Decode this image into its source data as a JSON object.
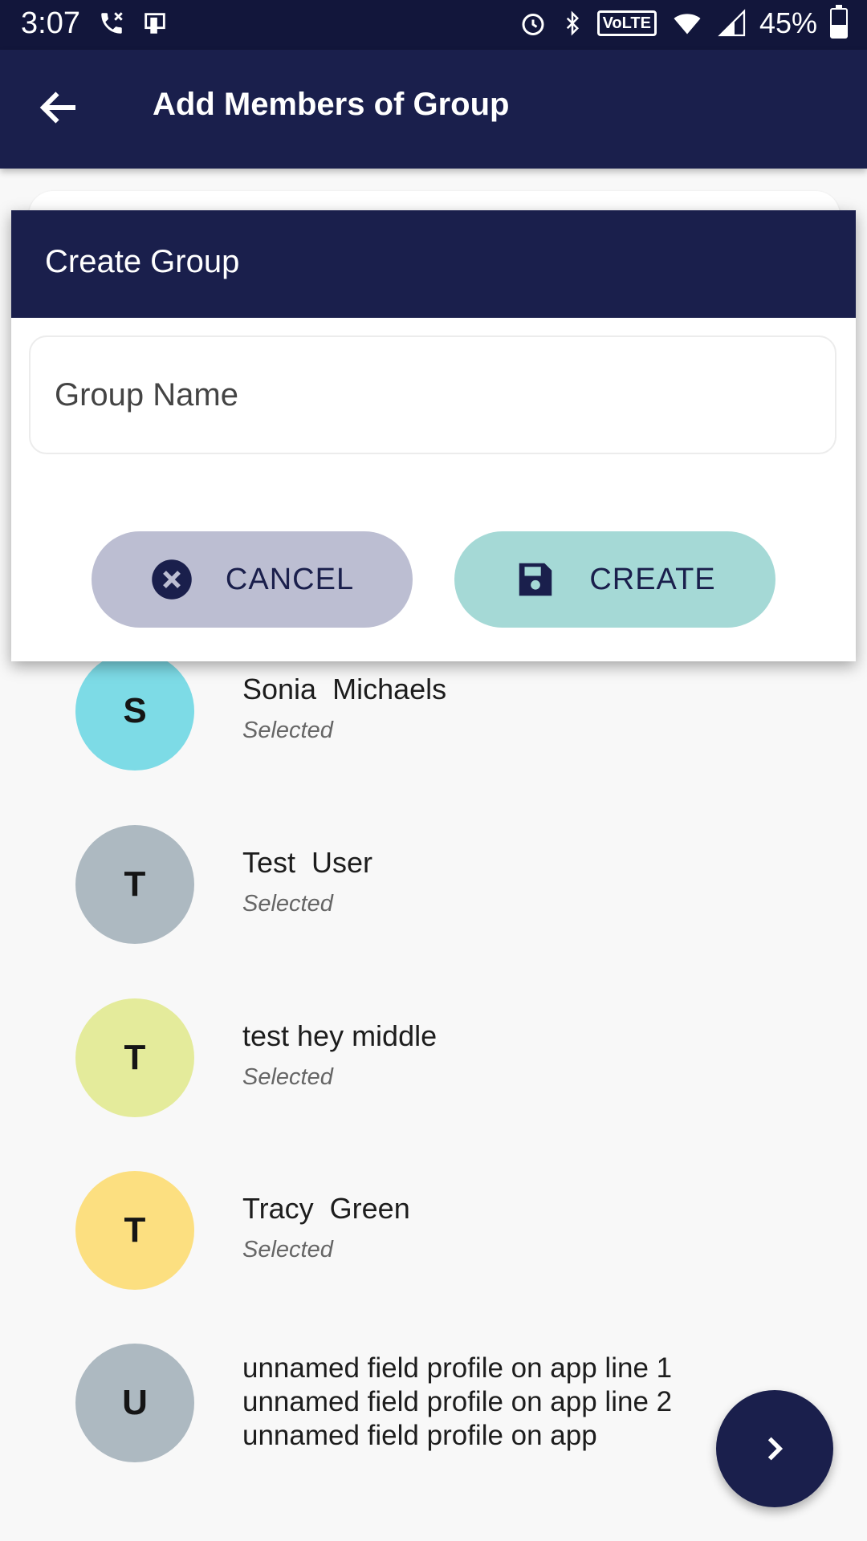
{
  "status_bar": {
    "time": "3:07",
    "volte": "VoLTE",
    "battery": "45%",
    "battery_level": 0.45
  },
  "app_bar": {
    "title": "Add Members of Group"
  },
  "dialog": {
    "title": "Create Group",
    "group_name_placeholder": "Group Name",
    "group_name_value": "",
    "cancel_label": "CANCEL",
    "create_label": "CREATE"
  },
  "members": [
    {
      "initial": "S",
      "name": "Sonia  Michaels",
      "status": "Selected",
      "color": "#7ddbe6"
    },
    {
      "initial": "T",
      "name": "Test  User",
      "status": "Selected",
      "color": "#adb9c1"
    },
    {
      "initial": "T",
      "name": "test hey middle",
      "status": "Selected",
      "color": "#e4eb9b"
    },
    {
      "initial": "T",
      "name": "Tracy  Green",
      "status": "Selected",
      "color": "#fcdf80"
    },
    {
      "initial": "U",
      "name_lines": [
        "unnamed field profile on app line 1",
        "unnamed field profile on app line 2",
        "unnamed field profile on app"
      ],
      "color": "#adb9c1"
    }
  ],
  "colors": {
    "primary": "#1a1f4c",
    "cancel_bg": "#bcbed2",
    "create_bg": "#a5d9d6"
  }
}
